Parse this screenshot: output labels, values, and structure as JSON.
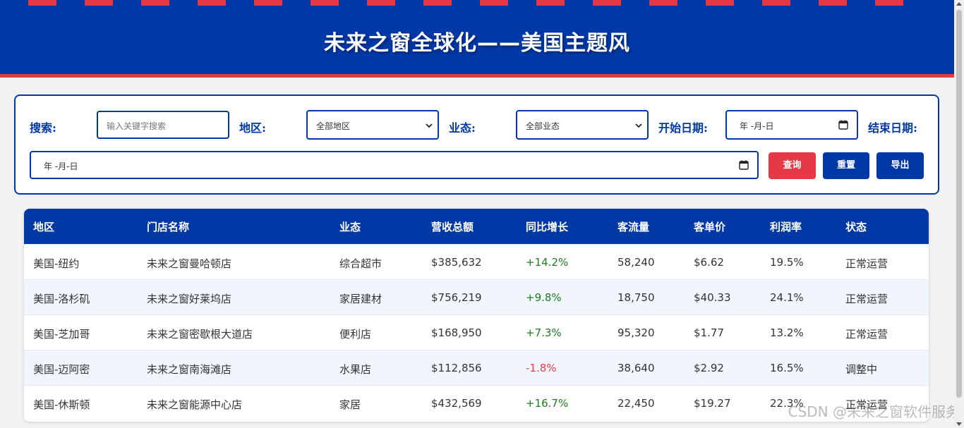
{
  "header": {
    "title": "未来之窗全球化——美国主题风"
  },
  "filters": {
    "search_label": "搜索:",
    "search_placeholder": "输入关键字搜索",
    "region_label": "地区:",
    "region_selected": "全部地区",
    "business_label": "业态:",
    "business_selected": "全部业态",
    "start_label": "开始日期:",
    "start_value": "年 -月-日",
    "end_label": "结束日期:",
    "end_value": "年 -月-日"
  },
  "buttons": {
    "query": "查询",
    "reset": "重置",
    "export": "导出"
  },
  "table": {
    "columns": [
      "地区",
      "门店名称",
      "业态",
      "营收总额",
      "同比增长",
      "客流量",
      "客单价",
      "利润率",
      "状态"
    ],
    "rows": [
      [
        "美国-纽约",
        "未来之窗曼哈顿店",
        "综合超市",
        "$385,632",
        "+14.2%",
        "58,240",
        "$6.62",
        "19.5%",
        "正常运营"
      ],
      [
        "美国-洛杉矶",
        "未来之窗好莱坞店",
        "家居建材",
        "$756,219",
        "+9.8%",
        "18,750",
        "$40.33",
        "24.1%",
        "正常运营"
      ],
      [
        "美国-芝加哥",
        "未来之窗密歇根大道店",
        "便利店",
        "$168,950",
        "+7.3%",
        "95,320",
        "$1.77",
        "13.2%",
        "正常运营"
      ],
      [
        "美国-迈阿密",
        "未来之窗南海滩店",
        "水果店",
        "$112,856",
        "-1.8%",
        "38,640",
        "$2.92",
        "16.5%",
        "调整中"
      ],
      [
        "美国-休斯顿",
        "未来之窗能源中心店",
        "家居",
        "$432,569",
        "+16.7%",
        "22,450",
        "$19.27",
        "22.3%",
        "正常运营"
      ]
    ]
  },
  "watermark": "CSDN @未来之窗软件服务",
  "colors": {
    "primary": "#0038a6",
    "accent": "#e63946",
    "positive": "#1e7b1e"
  }
}
